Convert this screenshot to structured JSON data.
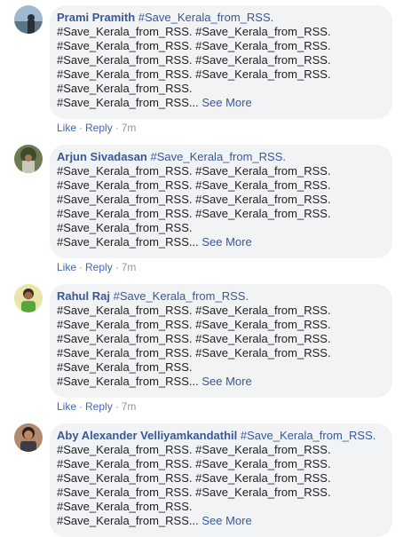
{
  "comments": [
    {
      "author": "Prami Pramith",
      "hashtag": "#Save_Kerala_from_RSS.",
      "lines": [
        "#Save_Kerala_from_RSS. #Save_Kerala_from_RSS.",
        "#Save_Kerala_from_RSS. #Save_Kerala_from_RSS.",
        "#Save_Kerala_from_RSS. #Save_Kerala_from_RSS.",
        "#Save_Kerala_from_RSS. #Save_Kerala_from_RSS.",
        "#Save_Kerala_from_RSS."
      ],
      "last_line": "#Save_Kerala_from_RSS...",
      "see_more": "See More",
      "like": "Like",
      "reply": "Reply",
      "time": "7m"
    },
    {
      "author": "Arjun Sivadasan",
      "hashtag": "#Save_Kerala_from_RSS.",
      "lines": [
        "#Save_Kerala_from_RSS. #Save_Kerala_from_RSS.",
        "#Save_Kerala_from_RSS. #Save_Kerala_from_RSS.",
        "#Save_Kerala_from_RSS. #Save_Kerala_from_RSS.",
        "#Save_Kerala_from_RSS. #Save_Kerala_from_RSS.",
        "#Save_Kerala_from_RSS."
      ],
      "last_line": "#Save_Kerala_from_RSS...",
      "see_more": "See More",
      "like": "Like",
      "reply": "Reply",
      "time": "7m"
    },
    {
      "author": "Rahul Raj",
      "hashtag": "#Save_Kerala_from_RSS.",
      "lines": [
        "#Save_Kerala_from_RSS. #Save_Kerala_from_RSS.",
        "#Save_Kerala_from_RSS. #Save_Kerala_from_RSS.",
        "#Save_Kerala_from_RSS. #Save_Kerala_from_RSS.",
        "#Save_Kerala_from_RSS. #Save_Kerala_from_RSS.",
        "#Save_Kerala_from_RSS."
      ],
      "last_line": "#Save_Kerala_from_RSS...",
      "see_more": "See More",
      "like": "Like",
      "reply": "Reply",
      "time": "7m"
    },
    {
      "author": "Aby Alexander Velliyamkandathil",
      "hashtag": "#Save_Kerala_from_RSS.",
      "lines": [
        "#Save_Kerala_from_RSS. #Save_Kerala_from_RSS.",
        "#Save_Kerala_from_RSS. #Save_Kerala_from_RSS.",
        "#Save_Kerala_from_RSS. #Save_Kerala_from_RSS.",
        "#Save_Kerala_from_RSS. #Save_Kerala_from_RSS.",
        "#Save_Kerala_from_RSS."
      ],
      "last_line": "#Save_Kerala_from_RSS...",
      "see_more": "See More"
    }
  ],
  "colors": {
    "link": "#385898",
    "action_link": "#4267b2",
    "bubble_bg": "#f2f3f5",
    "meta": "#90949c"
  }
}
